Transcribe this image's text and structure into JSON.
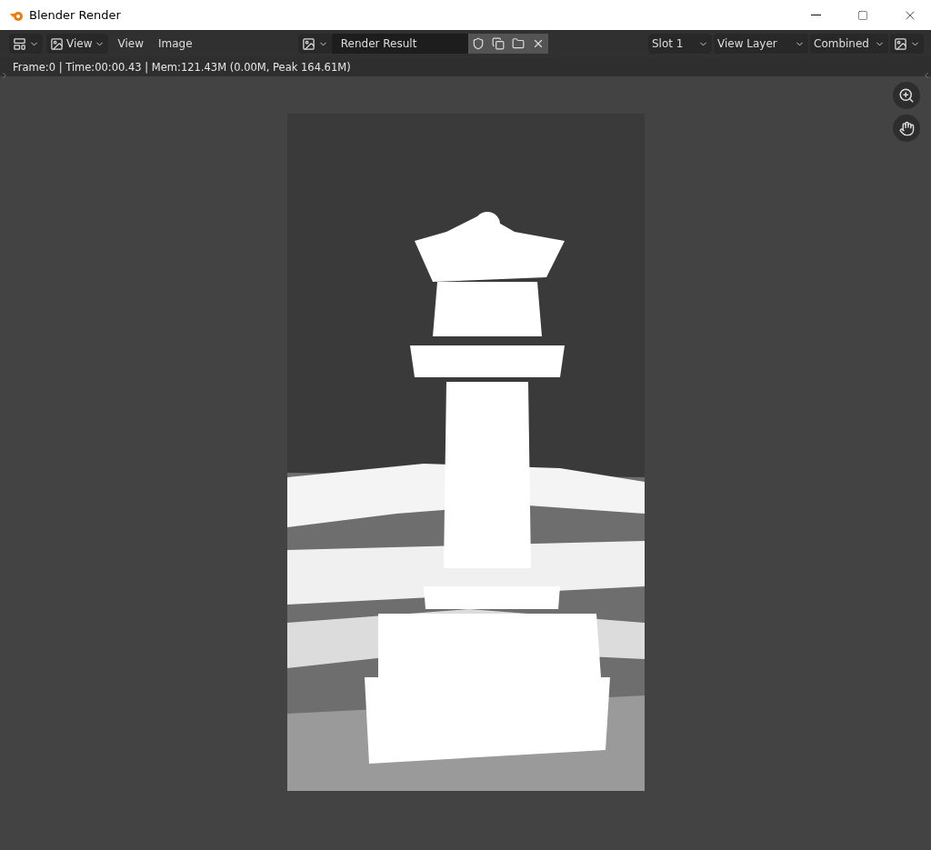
{
  "window": {
    "title": "Blender Render"
  },
  "header": {
    "view_menu": "View",
    "menus": [
      "View",
      "Image"
    ],
    "image_name": "Render Result",
    "slot": "Slot 1",
    "view_layer": "View Layer",
    "pass": "Combined"
  },
  "info": "Frame:0 | Time:00:00.43 | Mem:121.43M (0.00M, Peak 164.61M)"
}
